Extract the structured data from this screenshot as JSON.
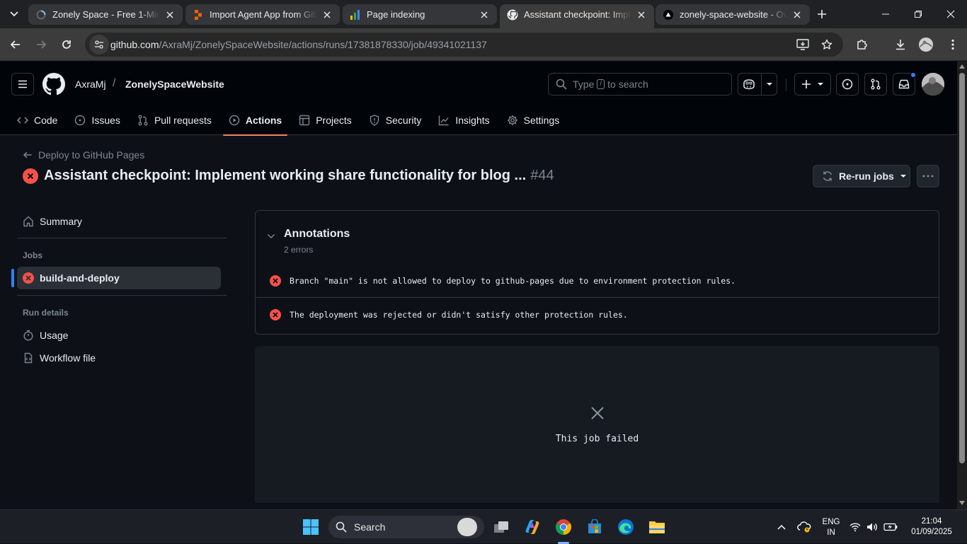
{
  "browser": {
    "tabs": [
      {
        "title": "Zonely Space - Free 1-Minute",
        "favicon": "zonely-loading-icon"
      },
      {
        "title": "Import Agent App from GitHub",
        "favicon": "replit-icon"
      },
      {
        "title": "Page indexing",
        "favicon": "search-console-icon"
      },
      {
        "title": "Assistant checkpoint: Implement",
        "favicon": "github-icon",
        "active": true
      },
      {
        "title": "zonely-space-website - Overview",
        "favicon": "vercel-icon"
      }
    ],
    "url_host": "github.com",
    "url_path": "/AxraMj/ZonelySpaceWebsite/actions/runs/17381878330/job/49341021137"
  },
  "github": {
    "owner": "AxraMj",
    "separator": "/",
    "repo": "ZonelySpaceWebsite",
    "search_prefix": "Type",
    "search_key": "/",
    "search_suffix": "to search",
    "nav": [
      {
        "label": "Code",
        "icon": "code-icon"
      },
      {
        "label": "Issues",
        "icon": "issue-opened-icon"
      },
      {
        "label": "Pull requests",
        "icon": "git-pull-request-icon"
      },
      {
        "label": "Actions",
        "icon": "play-icon",
        "selected": true
      },
      {
        "label": "Projects",
        "icon": "table-icon"
      },
      {
        "label": "Security",
        "icon": "shield-icon"
      },
      {
        "label": "Insights",
        "icon": "graph-icon"
      },
      {
        "label": "Settings",
        "icon": "gear-icon"
      }
    ]
  },
  "run": {
    "back_label": "Deploy to GitHub Pages",
    "title": "Assistant checkpoint: Implement working share functionality for blog ...",
    "number": "#44",
    "rerun_label": "Re-run jobs",
    "status_color": "#f85149"
  },
  "sidebar": {
    "summary": "Summary",
    "jobs_heading": "Jobs",
    "job": "build-and-deploy",
    "run_details_heading": "Run details",
    "usage": "Usage",
    "workflow_file": "Workflow file"
  },
  "annotations": {
    "title": "Annotations",
    "count": "2 errors",
    "items": [
      "Branch \"main\" is not allowed to deploy to github-pages due to environment protection rules.",
      "The deployment was rejected or didn't satisfy other protection rules."
    ]
  },
  "job_panel": {
    "message": "This job failed"
  },
  "taskbar": {
    "search_label": "Search",
    "lang_top": "ENG",
    "lang_bottom": "IN",
    "time": "21:04",
    "date": "01/09/2025"
  },
  "colors": {
    "accent": "#f78166",
    "link_blue": "#2f81f7",
    "error": "#f85149",
    "background": "#0d1117"
  }
}
